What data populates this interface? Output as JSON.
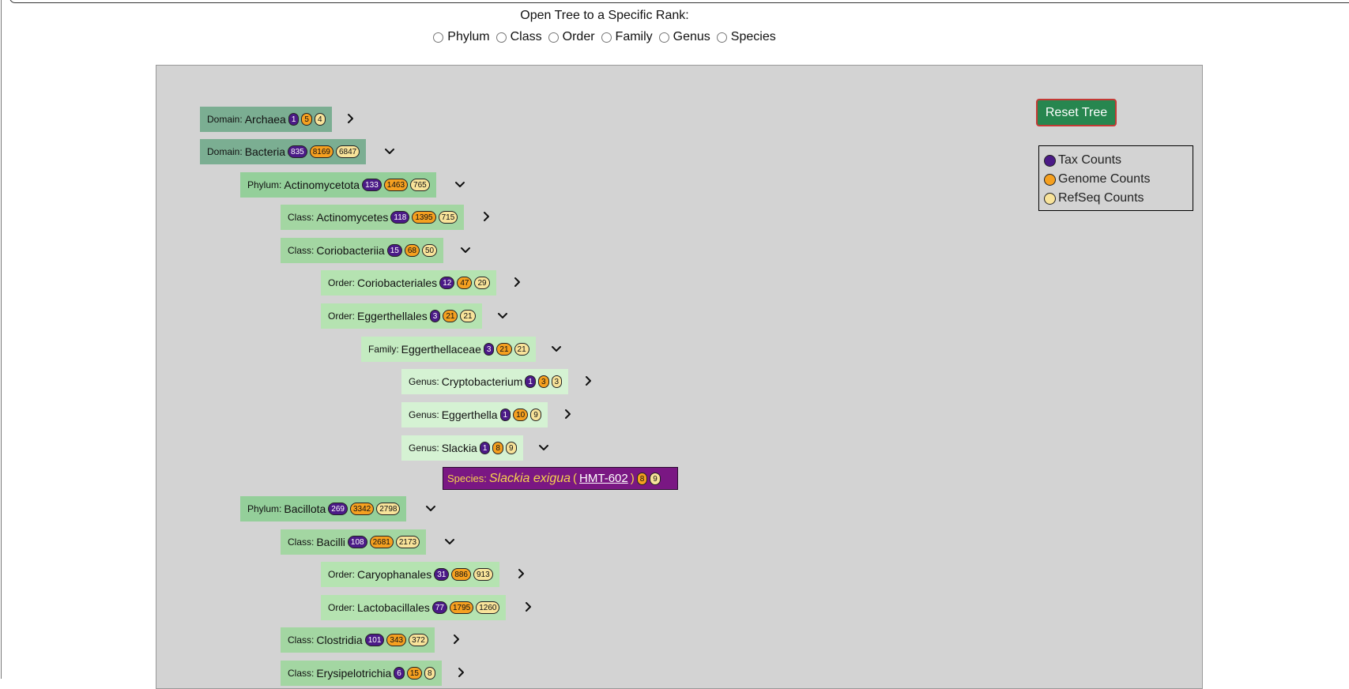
{
  "rank_selector": {
    "title": "Open Tree to a Specific Rank:",
    "options": [
      "Phylum",
      "Class",
      "Order",
      "Family",
      "Genus",
      "Species"
    ]
  },
  "reset_button": {
    "label": "Reset Tree",
    "color": "#27864f"
  },
  "legend": {
    "tax": {
      "label": "Tax Counts",
      "color": "#4b1a87"
    },
    "genome": {
      "label": "Genome Counts",
      "color": "#f5a020"
    },
    "refseq": {
      "label": "RefSeq Counts",
      "color": "#f8e39a"
    }
  },
  "tree": {
    "nodes": [
      {
        "rank": "Domain:",
        "name": "Archaea",
        "tax": "1",
        "genome": "5",
        "refseq": "4",
        "expanded": false
      },
      {
        "rank": "Domain:",
        "name": "Bacteria",
        "tax": "835",
        "genome": "8169",
        "refseq": "6847",
        "expanded": true
      },
      {
        "rank": "Phylum:",
        "name": "Actinomycetota",
        "tax": "133",
        "genome": "1463",
        "refseq": "765",
        "expanded": true
      },
      {
        "rank": "Class:",
        "name": "Actinomycetes",
        "tax": "118",
        "genome": "1395",
        "refseq": "715",
        "expanded": false
      },
      {
        "rank": "Class:",
        "name": "Coriobacteriia",
        "tax": "15",
        "genome": "68",
        "refseq": "50",
        "expanded": true
      },
      {
        "rank": "Order:",
        "name": "Coriobacteriales",
        "tax": "12",
        "genome": "47",
        "refseq": "29",
        "expanded": false
      },
      {
        "rank": "Order:",
        "name": "Eggerthellales",
        "tax": "3",
        "genome": "21",
        "refseq": "21",
        "expanded": true
      },
      {
        "rank": "Family:",
        "name": "Eggerthellaceae",
        "tax": "3",
        "genome": "21",
        "refseq": "21",
        "expanded": true
      },
      {
        "rank": "Genus:",
        "name": "Cryptobacterium",
        "tax": "1",
        "genome": "3",
        "refseq": "3",
        "expanded": false
      },
      {
        "rank": "Genus:",
        "name": "Eggerthella",
        "tax": "1",
        "genome": "10",
        "refseq": "9",
        "expanded": false
      },
      {
        "rank": "Genus:",
        "name": "Slackia",
        "tax": "1",
        "genome": "8",
        "refseq": "9",
        "expanded": true
      },
      {
        "rank": "Phylum:",
        "name": "Bacillota",
        "tax": "269",
        "genome": "3342",
        "refseq": "2798",
        "expanded": true
      },
      {
        "rank": "Class:",
        "name": "Bacilli",
        "tax": "108",
        "genome": "2681",
        "refseq": "2173",
        "expanded": true
      },
      {
        "rank": "Order:",
        "name": "Caryophanales",
        "tax": "31",
        "genome": "886",
        "refseq": "913",
        "expanded": false
      },
      {
        "rank": "Order:",
        "name": "Lactobacillales",
        "tax": "77",
        "genome": "1795",
        "refseq": "1260",
        "expanded": false
      },
      {
        "rank": "Class:",
        "name": "Clostridia",
        "tax": "101",
        "genome": "343",
        "refseq": "372",
        "expanded": false
      },
      {
        "rank": "Class:",
        "name": "Erysipelotrichia",
        "tax": "6",
        "genome": "15",
        "refseq": "8",
        "expanded": false
      }
    ],
    "species": {
      "rank": "Species:",
      "name": "Slackia exigua",
      "open_paren": "(",
      "link": "HMT-602",
      "close_paren": ")",
      "genome": "8",
      "refseq": "9"
    }
  }
}
